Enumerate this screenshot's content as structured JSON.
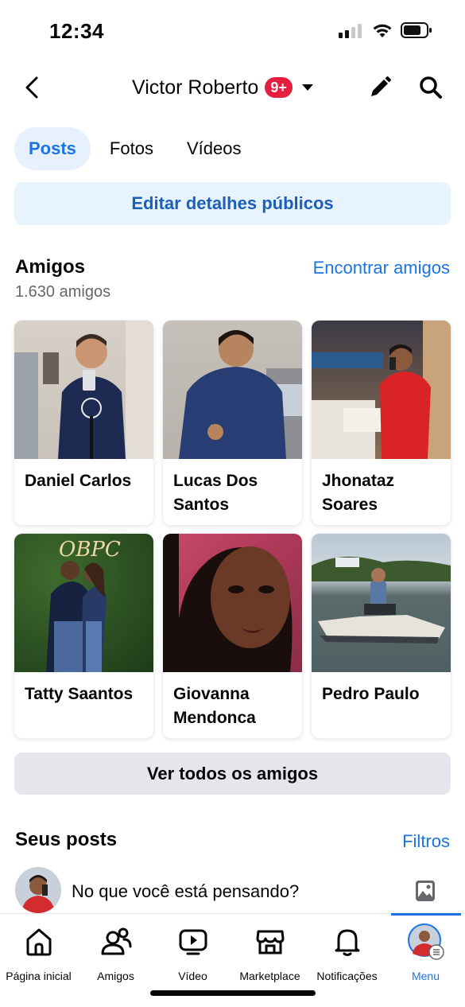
{
  "status_bar": {
    "time": "12:34"
  },
  "header": {
    "profile_name": "Victor Roberto",
    "notification_badge": "9+",
    "icons": [
      "back-arrow-icon",
      "chevron-down-icon",
      "pencil-icon",
      "search-icon"
    ]
  },
  "tabs": [
    {
      "label": "Posts",
      "active": true
    },
    {
      "label": "Fotos",
      "active": false
    },
    {
      "label": "Vídeos",
      "active": false
    }
  ],
  "edit_details_label": "Editar detalhes públicos",
  "friends": {
    "title": "Amigos",
    "find_label": "Encontrar amigos",
    "count": "1.630 amigos",
    "list": [
      {
        "name": "Daniel Carlos"
      },
      {
        "name": "Lucas Dos Santos"
      },
      {
        "name": "Jhonataz Soares"
      },
      {
        "name": "Tatty Saantos"
      },
      {
        "name": "Giovanna Mendonca"
      },
      {
        "name": "Pedro Paulo"
      }
    ],
    "see_all_label": "Ver todos os amigos"
  },
  "posts": {
    "title": "Seus posts",
    "filter_label": "Filtros",
    "composer_placeholder": "No que você está pensando?"
  },
  "bottom_nav": [
    {
      "label": "Página inicial",
      "icon": "home-icon",
      "active": false
    },
    {
      "label": "Amigos",
      "icon": "friends-icon",
      "active": false
    },
    {
      "label": "Vídeo",
      "icon": "video-icon",
      "active": false
    },
    {
      "label": "Marketplace",
      "icon": "marketplace-icon",
      "active": false
    },
    {
      "label": "Notificações",
      "icon": "bell-icon",
      "active": false
    },
    {
      "label": "Menu",
      "icon": "menu-avatar-icon",
      "active": true
    }
  ],
  "colors": {
    "accent": "#1b74e4",
    "badge": "#e41e3f",
    "button_bg": "#e4e6eb",
    "light_blue_bg": "#e7f3ff"
  }
}
